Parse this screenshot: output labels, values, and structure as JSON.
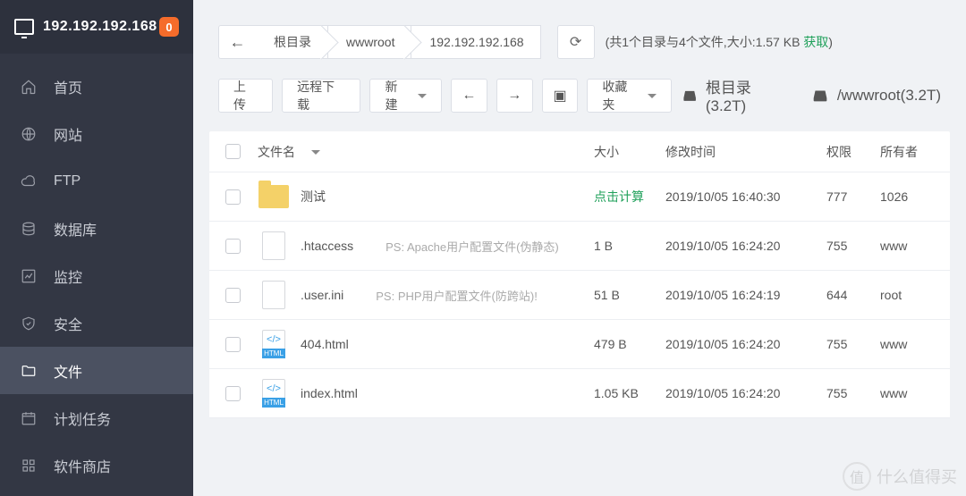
{
  "header": {
    "ip": "192.192.192.168",
    "badge": "0"
  },
  "nav": {
    "items": [
      {
        "key": "home",
        "label": "首页",
        "icon": "home-icon"
      },
      {
        "key": "site",
        "label": "网站",
        "icon": "globe-icon"
      },
      {
        "key": "ftp",
        "label": "FTP",
        "icon": "cloud-icon"
      },
      {
        "key": "db",
        "label": "数据库",
        "icon": "database-icon"
      },
      {
        "key": "monitor",
        "label": "监控",
        "icon": "chart-icon"
      },
      {
        "key": "security",
        "label": "安全",
        "icon": "shield-icon"
      },
      {
        "key": "files",
        "label": "文件",
        "icon": "folder-icon",
        "active": true
      },
      {
        "key": "cron",
        "label": "计划任务",
        "icon": "calendar-icon"
      },
      {
        "key": "store",
        "label": "软件商店",
        "icon": "grid-icon"
      }
    ]
  },
  "breadcrumb": {
    "segments": [
      "根目录",
      "wwwroot",
      "192.192.192.168"
    ]
  },
  "summary": {
    "text": "(共1个目录与4个文件,大小:1.57 KB ",
    "get_label": "获取",
    "close": ")"
  },
  "toolbar": {
    "upload": "上传",
    "remote_dl": "远程下载",
    "new": "新建",
    "fav": "收藏夹"
  },
  "disks": [
    {
      "label": "根目录(3.2T)"
    },
    {
      "label": "/wwwroot(3.2T)"
    }
  ],
  "columns": {
    "name": "文件名",
    "size": "大小",
    "mtime": "修改时间",
    "perm": "权限",
    "owner": "所有者"
  },
  "rows": [
    {
      "icon": "folder",
      "name": "测试",
      "ps": "",
      "size": "点击计算",
      "size_link": true,
      "mtime": "2019/10/05 16:40:30",
      "perm": "777",
      "owner": "1026"
    },
    {
      "icon": "file",
      "name": ".htaccess",
      "ps": "PS: Apache用户配置文件(伪静态)",
      "size": "1 B",
      "mtime": "2019/10/05 16:24:20",
      "perm": "755",
      "owner": "www"
    },
    {
      "icon": "file",
      "name": ".user.ini",
      "ps": "PS: PHP用户配置文件(防跨站)!",
      "size": "51 B",
      "mtime": "2019/10/05 16:24:19",
      "perm": "644",
      "owner": "root"
    },
    {
      "icon": "html",
      "name": "404.html",
      "ps": "",
      "size": "479 B",
      "mtime": "2019/10/05 16:24:20",
      "perm": "755",
      "owner": "www"
    },
    {
      "icon": "html",
      "name": "index.html",
      "ps": "",
      "size": "1.05 KB",
      "mtime": "2019/10/05 16:24:20",
      "perm": "755",
      "owner": "www"
    }
  ],
  "watermark": {
    "icon": "值",
    "text": "什么值得买"
  }
}
